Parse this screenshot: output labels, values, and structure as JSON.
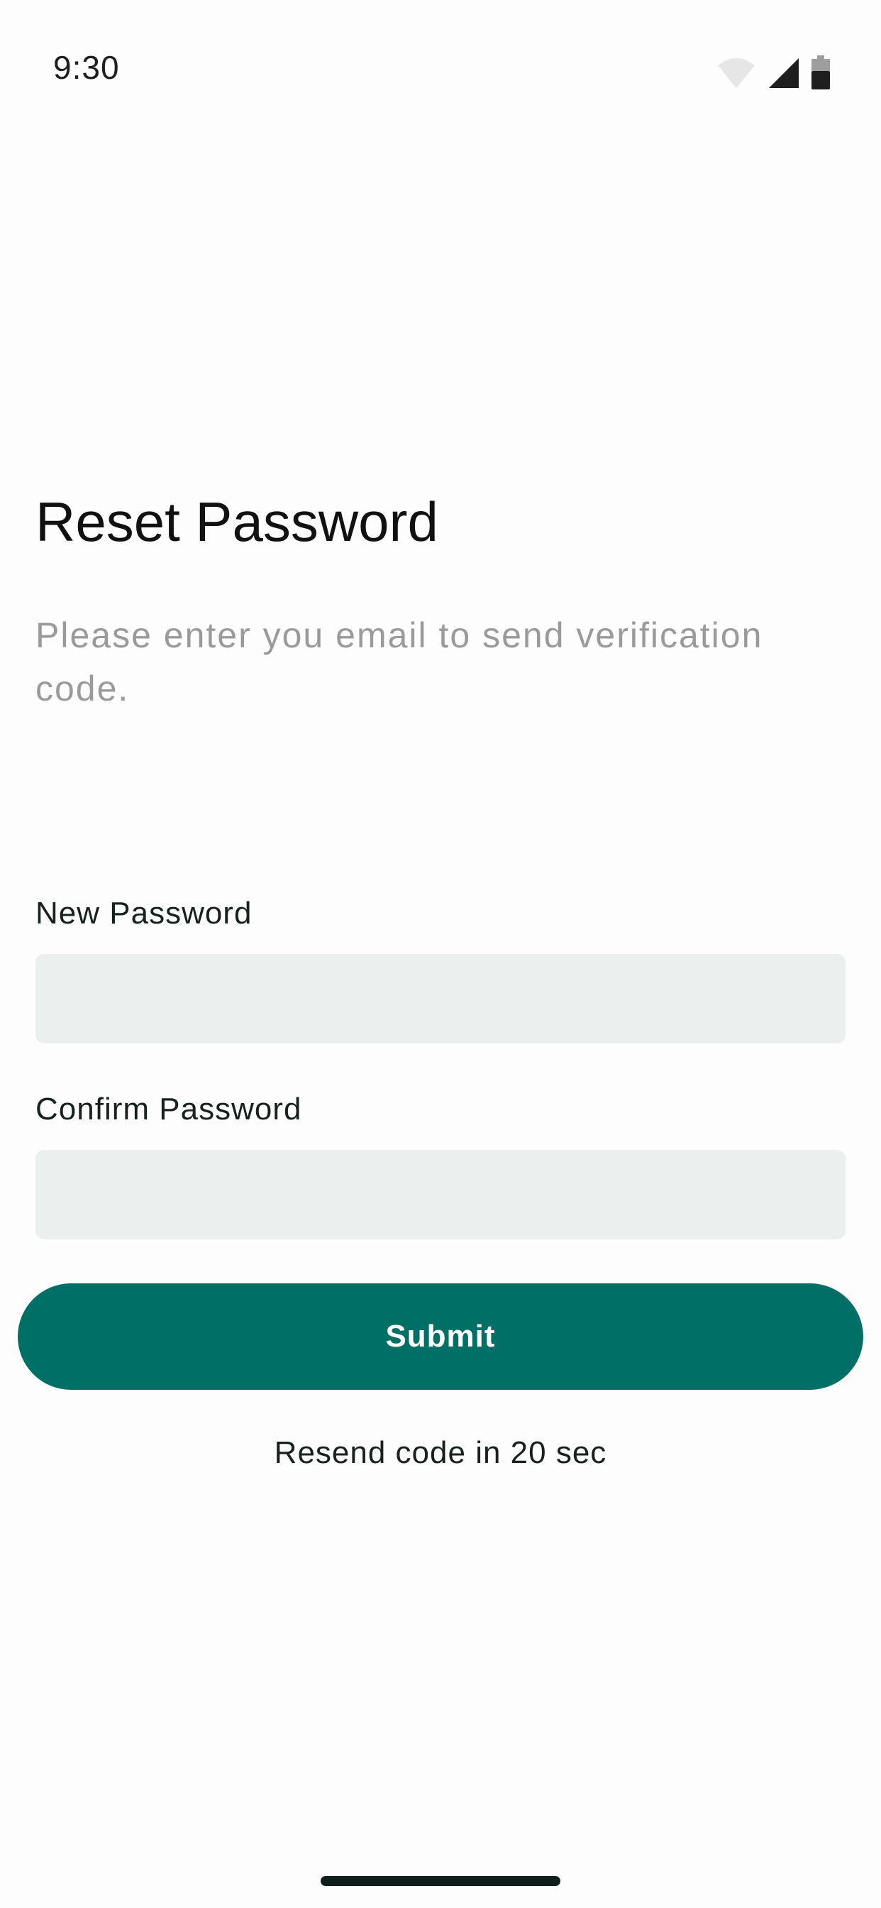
{
  "status_bar": {
    "time": "9:30",
    "icons": [
      "wifi-icon",
      "cellular-signal-icon",
      "battery-icon"
    ]
  },
  "header": {
    "title": "Reset Password",
    "subtitle": "Please enter you email to send verification code."
  },
  "form": {
    "new_password_label": "New Password",
    "new_password_value": "",
    "confirm_password_label": "Confirm Password",
    "confirm_password_value": "",
    "submit_label": "Submit"
  },
  "footer": {
    "resend_text": "Resend code in 20 sec"
  },
  "colors": {
    "accent": "#006f66",
    "input_background": "#ebf0ee",
    "subtitle_text": "#9a9a9a",
    "background": "#fefdfd"
  }
}
